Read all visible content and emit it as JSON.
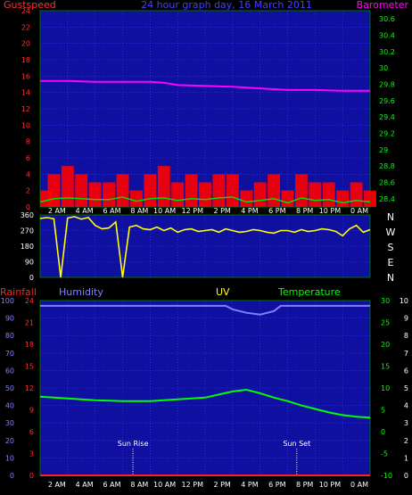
{
  "header": {
    "left_label": "Gustspeed",
    "title": "24 hour graph day, 16 March 2011",
    "right_label": "Barometer"
  },
  "colors": {
    "plot_bg": "#1010a0",
    "frame": "#007000",
    "grid": "#3a3aff",
    "gust": "#ff0000",
    "barometer": "#ff00ff",
    "wind_avg": "#00e000",
    "wind_dir": "#ffff00",
    "humidity": "#8080ff",
    "temperature": "#00ff00",
    "rainfall": "#ff2020",
    "title_blue": "#4040ff",
    "uv": "#ffff00",
    "tick_red": "#ff3030",
    "tick_green": "#00ff00",
    "tick_white": "#ffffff",
    "tick_magenta": "#ff00ff",
    "tick_blue": "#8080ff"
  },
  "time_ticks": [
    "2 AM",
    "4 AM",
    "6 AM",
    "8 AM",
    "10 AM",
    "12 PM",
    "2 PM",
    "4 PM",
    "6 PM",
    "8 PM",
    "10 PM",
    "0 AM"
  ],
  "middle_header": {
    "rainfall": "Rainfall",
    "humidity": "Humidity",
    "uv": "UV",
    "temperature": "Temperature"
  },
  "compass_letters": [
    "N",
    "W",
    "S",
    "E",
    "N"
  ],
  "markers": {
    "sunrise": {
      "label": "Sun Rise",
      "time": "06:45"
    },
    "sunset": {
      "label": "Sun Set",
      "time": "18:40"
    }
  },
  "chart_data": [
    {
      "id": "wind-pressure",
      "type": "line",
      "x_unit": "hours since 00:00, 16 March 2011",
      "xlim": [
        0,
        24
      ],
      "left_axis": {
        "ticks": [
          "24",
          "22",
          "20",
          "18",
          "16",
          "14",
          "12",
          "10",
          "8",
          "6",
          "4",
          "2",
          "0"
        ],
        "ylim": [
          0,
          24
        ]
      },
      "right_axis": {
        "ticks": [
          "30.6",
          "30.4",
          "30.2",
          "30",
          "29.8",
          "29.6",
          "29.4",
          "29.2",
          "29",
          "28.8",
          "28.6",
          "28.4"
        ],
        "ylim": [
          28.3,
          30.7
        ]
      },
      "series": [
        {
          "name": "Gustspeed",
          "axis": "left",
          "style": "bars",
          "x": [
            0,
            1,
            2,
            3,
            4,
            5,
            6,
            7,
            8,
            9,
            10,
            11,
            12,
            13,
            14,
            15,
            16,
            17,
            18,
            19,
            20,
            21,
            22,
            23,
            24
          ],
          "y": [
            2,
            4,
            5,
            4,
            3,
            3,
            4,
            2,
            4,
            5,
            3,
            4,
            3,
            4,
            4,
            2,
            3,
            4,
            2,
            4,
            3,
            3,
            2,
            3,
            2
          ]
        },
        {
          "axis": "left",
          "style": "line",
          "x": [
            0,
            1,
            2,
            3,
            4,
            5,
            6,
            7,
            8,
            9,
            10,
            11,
            12,
            13,
            14,
            15,
            16,
            17,
            18,
            19,
            20,
            21,
            22,
            23,
            24
          ],
          "y": [
            0.6,
            1.0,
            1.1,
            1.0,
            0.9,
            0.9,
            1.2,
            0.7,
            1.0,
            1.1,
            0.8,
            1.0,
            0.9,
            1.1,
            1.2,
            0.6,
            0.8,
            1.0,
            0.5,
            1.1,
            0.8,
            0.9,
            0.5,
            0.8,
            0.6
          ]
        },
        {
          "name": "Barometer",
          "axis": "right",
          "style": "line",
          "x": [
            0,
            2,
            4,
            6,
            8,
            9,
            10,
            12,
            14,
            16,
            18,
            20,
            22,
            24
          ],
          "y": [
            29.84,
            29.84,
            29.83,
            29.83,
            29.83,
            29.82,
            29.79,
            29.78,
            29.77,
            29.75,
            29.73,
            29.73,
            29.72,
            29.72
          ]
        }
      ]
    },
    {
      "id": "wind-direction",
      "type": "line",
      "x_unit": "hours since 00:00, 16 March 2011",
      "xlim": [
        0,
        24
      ],
      "left_axis": {
        "ticks": [
          "360",
          "270",
          "180",
          "90",
          "0"
        ],
        "ylim": [
          0,
          360
        ]
      },
      "right_axis": {
        "ticks": [
          "N",
          "W",
          "S",
          "E",
          "N"
        ]
      },
      "series": [
        {
          "axis": "left",
          "style": "line",
          "x": [
            0,
            0.5,
            1,
            1.5,
            2,
            2.5,
            3,
            3.5,
            4,
            4.5,
            5,
            5.5,
            6,
            6.5,
            7,
            7.5,
            8,
            8.5,
            9,
            9.5,
            10,
            10.5,
            11,
            11.5,
            12,
            12.5,
            13,
            13.5,
            14,
            14.5,
            15,
            15.5,
            16,
            16.5,
            17,
            17.5,
            18,
            18.5,
            19,
            19.5,
            20,
            20.5,
            21,
            21.5,
            22,
            22.5,
            23,
            23.5,
            24
          ],
          "y": [
            340,
            345,
            338,
            0,
            342,
            350,
            336,
            345,
            300,
            280,
            285,
            320,
            0,
            290,
            300,
            280,
            275,
            290,
            270,
            285,
            260,
            275,
            280,
            265,
            270,
            275,
            260,
            280,
            270,
            260,
            265,
            275,
            270,
            260,
            255,
            270,
            270,
            260,
            275,
            265,
            270,
            280,
            275,
            265,
            240,
            280,
            300,
            260,
            275
          ]
        }
      ]
    },
    {
      "id": "temperature-humidity",
      "type": "line",
      "x_unit": "hours since 00:00, 16 March 2011",
      "xlim": [
        0,
        24
      ],
      "axes": {
        "humidity": {
          "ticks": [
            "100",
            "90",
            "80",
            "70",
            "60",
            "50",
            "40",
            "30",
            "20",
            "10",
            "0"
          ],
          "ylim": [
            0,
            100
          ]
        },
        "rainfall": {
          "ticks": [
            "24",
            "21",
            "18",
            "15",
            "12",
            "9",
            "6",
            "3",
            "0"
          ],
          "ylim": [
            0,
            24
          ]
        },
        "temperature": {
          "ticks": [
            "30",
            "25",
            "20",
            "15",
            "10",
            "5",
            "0",
            "-5",
            "-10"
          ],
          "ylim": [
            -10,
            30
          ]
        },
        "uv": {
          "ticks": [
            "10",
            "9",
            "8",
            "7",
            "6",
            "5",
            "4",
            "3",
            "2",
            "1",
            "0"
          ],
          "ylim": [
            0,
            10
          ]
        }
      },
      "series": [
        {
          "name": "Humidity",
          "axis": "humidity",
          "style": "line",
          "x": [
            0,
            2,
            4,
            6,
            8,
            10,
            12,
            13.5,
            14,
            15,
            16,
            17,
            17.5,
            18,
            20,
            22,
            24
          ],
          "y": [
            97,
            97,
            97,
            97,
            97,
            97,
            97,
            97,
            95,
            93,
            92,
            94,
            97,
            97,
            97,
            97,
            97
          ]
        },
        {
          "name": "Temperature",
          "axis": "temperature",
          "style": "line",
          "x": [
            0,
            2,
            4,
            6,
            8,
            10,
            12,
            14,
            15,
            16,
            17,
            18,
            19,
            20,
            21,
            22,
            23,
            24
          ],
          "y": [
            8,
            7.6,
            7.2,
            7.0,
            7.0,
            7.4,
            7.8,
            9.2,
            9.6,
            8.8,
            7.8,
            7.0,
            6.0,
            5.2,
            4.4,
            3.8,
            3.4,
            3.2
          ]
        },
        {
          "name": "Rainfall",
          "axis": "rainfall",
          "style": "line",
          "x": [
            0,
            24
          ],
          "y": [
            0,
            0
          ]
        }
      ]
    }
  ]
}
